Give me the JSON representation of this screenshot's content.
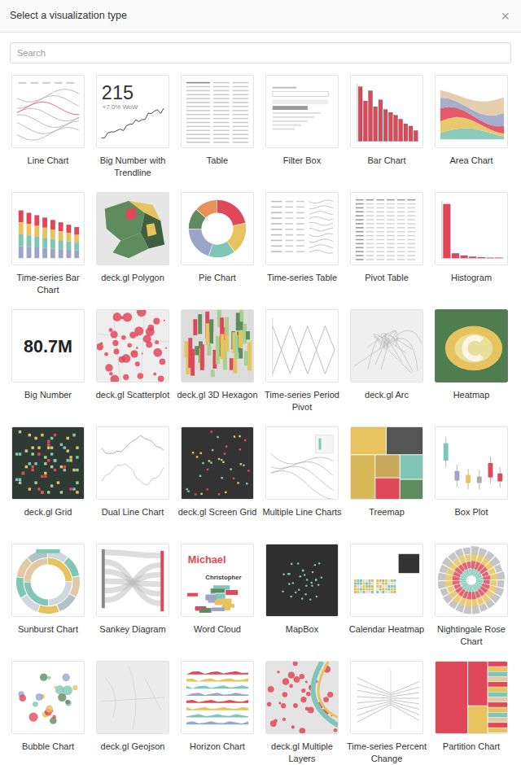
{
  "dialog": {
    "title": "Select a visualization type",
    "close": "×"
  },
  "search": {
    "placeholder": "Search"
  },
  "tiles": [
    {
      "label": "Line Chart",
      "kind": "line",
      "selected": false
    },
    {
      "label": "Big Number with Trendline",
      "kind": "bignumber-trend",
      "selected": false,
      "texts": [
        "215",
        "+7.0% WoW"
      ]
    },
    {
      "label": "Table",
      "kind": "table",
      "selected": false
    },
    {
      "label": "Filter Box",
      "kind": "filterbox",
      "selected": false
    },
    {
      "label": "Bar Chart",
      "kind": "bar",
      "selected": false,
      "values": [
        95,
        70,
        88,
        60,
        72,
        55,
        50,
        45,
        38,
        30,
        26,
        18
      ]
    },
    {
      "label": "Area Chart",
      "kind": "area",
      "selected": false
    },
    {
      "label": "Time-series Bar Chart",
      "kind": "tsbar",
      "selected": false
    },
    {
      "label": "deck.gl Polygon",
      "kind": "polygon",
      "selected": false
    },
    {
      "label": "Pie Chart",
      "kind": "pie",
      "selected": false
    },
    {
      "label": "Time-series Table",
      "kind": "tstable",
      "selected": false
    },
    {
      "label": "Pivot Table",
      "kind": "pivot",
      "selected": false
    },
    {
      "label": "Histogram",
      "kind": "histogram",
      "selected": false,
      "values": [
        100,
        9,
        5,
        3,
        2,
        1,
        1
      ]
    },
    {
      "label": "Big Number",
      "kind": "bignumber",
      "selected": false,
      "texts": [
        "80.7M"
      ]
    },
    {
      "label": "deck.gl Scatterplot",
      "kind": "scatter",
      "selected": false
    },
    {
      "label": "deck.gl 3D Hexagon",
      "kind": "hexagon",
      "selected": false
    },
    {
      "label": "Time-series Period Pivot",
      "kind": "period-pivot",
      "selected": false
    },
    {
      "label": "deck.gl Arc",
      "kind": "arc",
      "selected": false
    },
    {
      "label": "Heatmap",
      "kind": "heatmap",
      "selected": true
    },
    {
      "label": "deck.gl Grid",
      "kind": "grid",
      "selected": false
    },
    {
      "label": "Dual Line Chart",
      "kind": "dual-line",
      "selected": false
    },
    {
      "label": "deck.gl Screen Grid",
      "kind": "screen-grid",
      "selected": false
    },
    {
      "label": "Multiple Line Charts",
      "kind": "multi-line",
      "selected": false
    },
    {
      "label": "Treemap",
      "kind": "treemap",
      "selected": false
    },
    {
      "label": "Box Plot",
      "kind": "boxplot",
      "selected": false
    },
    {
      "label": "Sunburst Chart",
      "kind": "sunburst",
      "selected": false
    },
    {
      "label": "Sankey Diagram",
      "kind": "sankey",
      "selected": false
    },
    {
      "label": "Word Cloud",
      "kind": "wordcloud",
      "selected": false,
      "texts": [
        "Michael",
        "Christopher"
      ]
    },
    {
      "label": "MapBox",
      "kind": "mapbox",
      "selected": false
    },
    {
      "label": "Calendar Heatmap",
      "kind": "calendar",
      "selected": false
    },
    {
      "label": "Nightingale Rose Chart",
      "kind": "rose",
      "selected": false
    },
    {
      "label": "Bubble Chart",
      "kind": "bubble",
      "selected": false
    },
    {
      "label": "deck.gl Geojson",
      "kind": "geojson",
      "selected": false
    },
    {
      "label": "Horizon Chart",
      "kind": "horizon",
      "selected": false
    },
    {
      "label": "deck.gl Multiple Layers",
      "kind": "multilayers",
      "selected": false
    },
    {
      "label": "Time-series Percent Change",
      "kind": "percent-change",
      "selected": false
    },
    {
      "label": "Partition Chart",
      "kind": "partition",
      "selected": false
    }
  ]
}
